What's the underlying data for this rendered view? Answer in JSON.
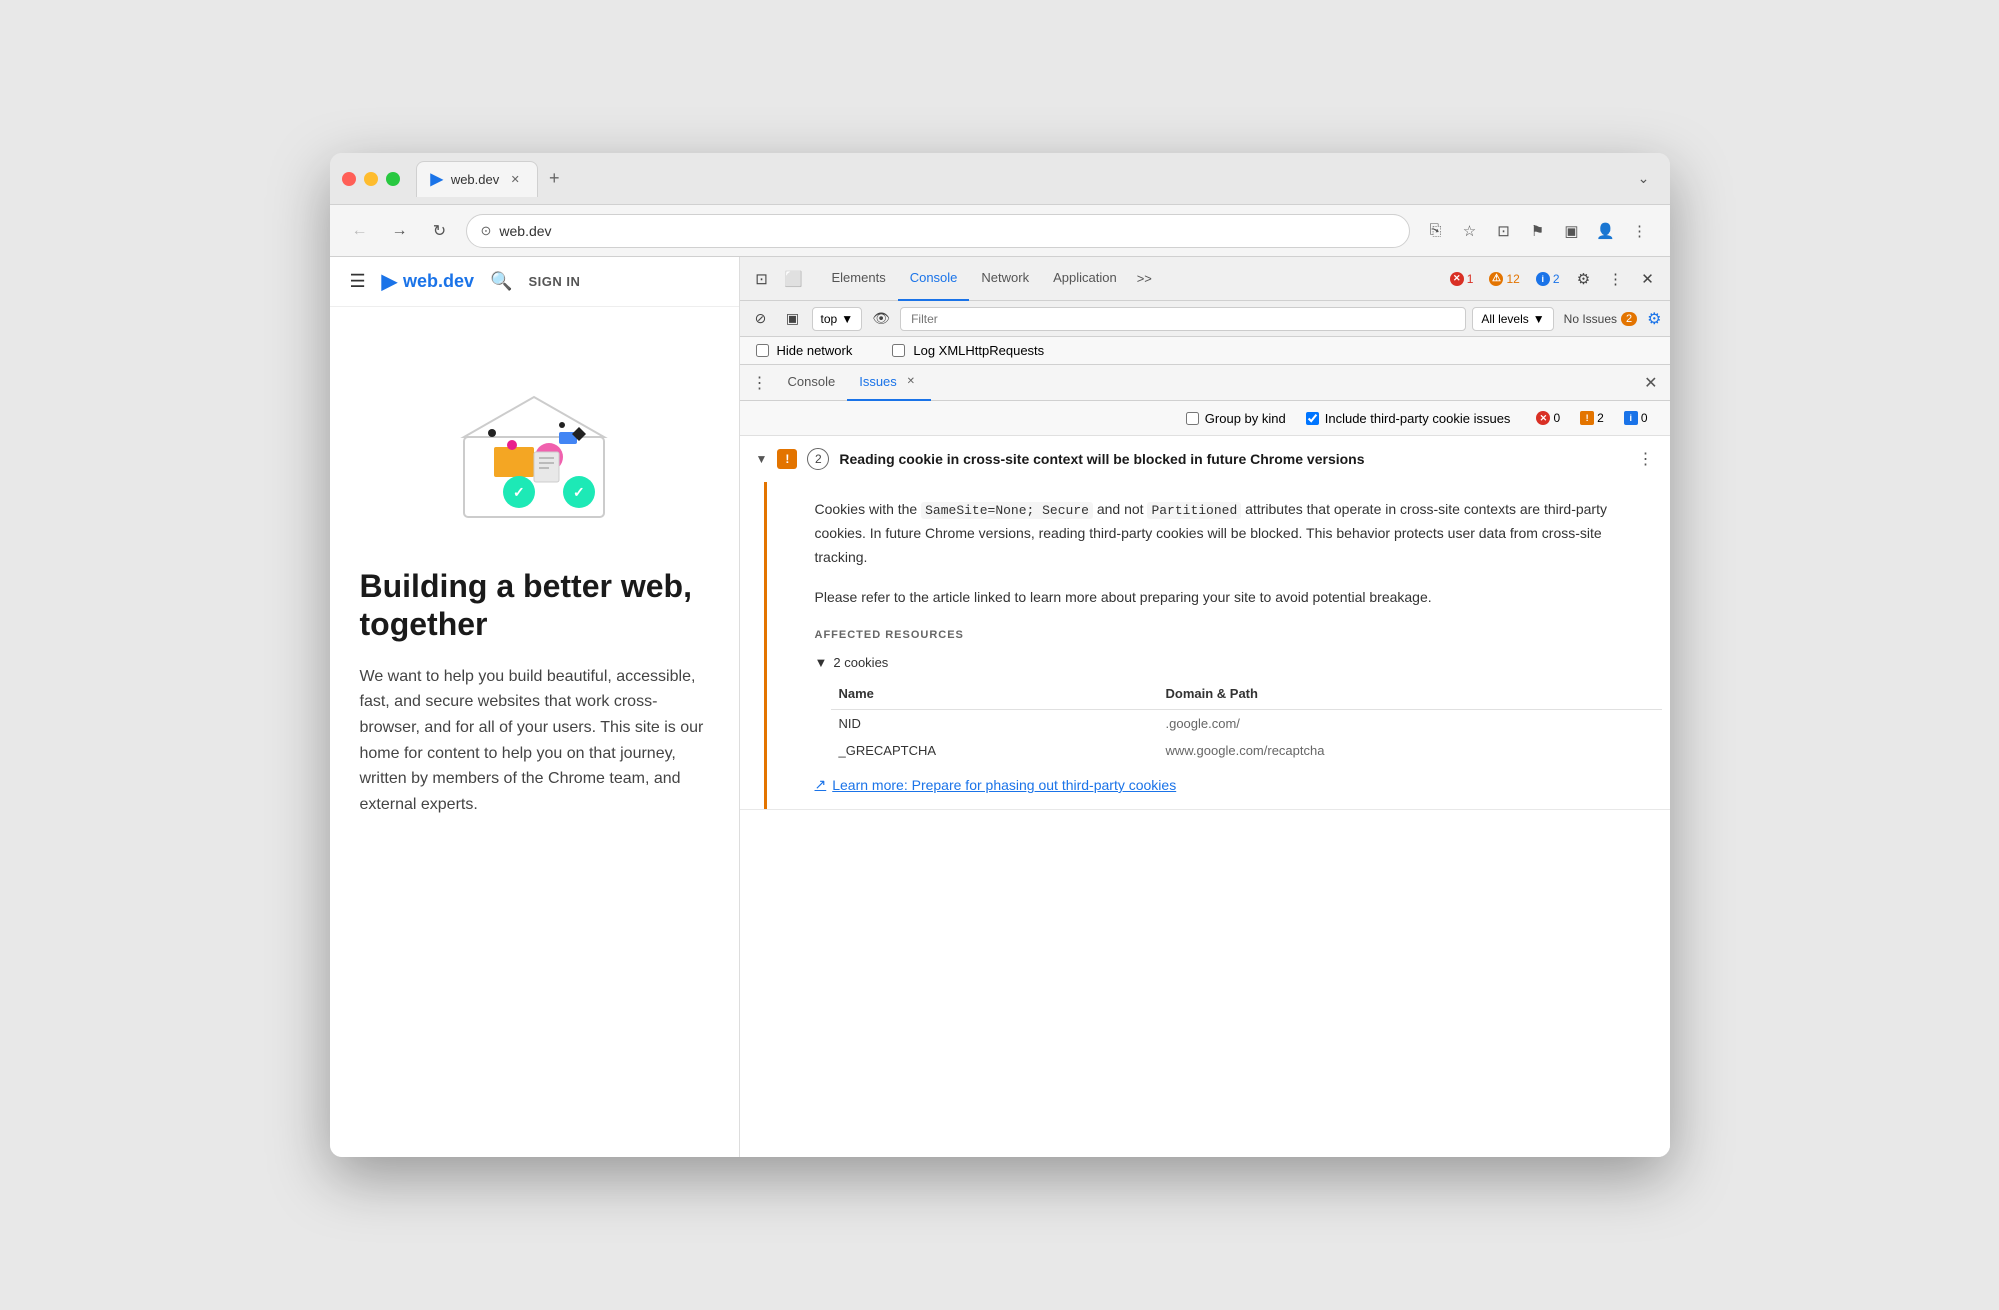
{
  "browser": {
    "title": "web.dev",
    "url": "web.dev",
    "tab_label": "web.dev"
  },
  "webpage": {
    "nav": {
      "logo": "web.dev",
      "search_label": "search",
      "signin": "SIGN IN"
    },
    "hero_title": "Building a better web, together",
    "hero_desc": "We want to help you build beautiful, accessible, fast, and secure websites that work cross-browser, and for all of your users. This site is our home for content to help you on that journey, written by members of the Chrome team, and external experts."
  },
  "devtools": {
    "tabs": {
      "elements": "Elements",
      "console": "Console",
      "network": "Network",
      "application": "Application",
      "more": ">>"
    },
    "active_tab": "Console",
    "error_count": "1",
    "warn_count": "12",
    "info_count": "2",
    "toolbar": {
      "context": "top",
      "filter_placeholder": "Filter",
      "levels": "All levels",
      "no_issues_label": "No Issues",
      "no_issues_count": "2"
    },
    "options": {
      "hide_network": "Hide network",
      "log_xml": "Log XMLHttpRequests"
    },
    "sub_tabs": {
      "console": "Console",
      "issues": "Issues"
    },
    "issues_panel": {
      "group_by": "Group by kind",
      "include_third_party": "Include third-party cookie issues",
      "error_count": "0",
      "warn_count": "2",
      "info_count": "0",
      "issue": {
        "title": "Reading cookie in cross-site context will be blocked in future Chrome versions",
        "count": "2",
        "desc1": "Cookies with the ",
        "code1": "SameSite=None; Secure",
        "desc1b": " and not ",
        "code2": "Partitioned",
        "desc1c": " attributes that operate in cross-site contexts are third-party cookies. In future Chrome versions, reading third-party cookies will be blocked. This behavior protects user data from cross-site tracking.",
        "desc2": "Please refer to the article linked to learn more about preparing your site to avoid potential breakage.",
        "affected_label": "AFFECTED RESOURCES",
        "cookies_toggle": "▼ 2 cookies",
        "table_headers": {
          "name": "Name",
          "domain": "Domain & Path"
        },
        "cookies": [
          {
            "name": "NID",
            "domain": ".google.com/"
          },
          {
            "name": "_GRECAPTCHA",
            "domain": "www.google.com/recaptcha"
          }
        ],
        "learn_more": "Learn more: Prepare for phasing out third-party cookies"
      }
    }
  }
}
